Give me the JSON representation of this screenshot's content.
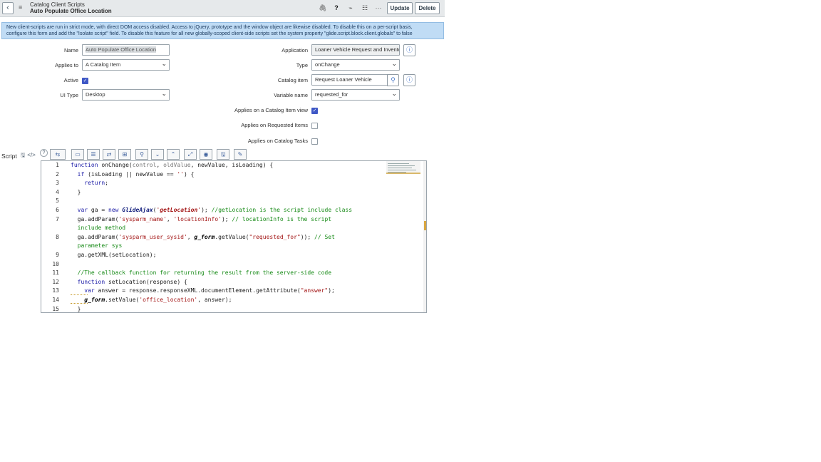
{
  "header": {
    "breadcrumb": "Catalog Client Scripts",
    "record_title": "Auto Populate Office Location",
    "icons": [
      "back-icon",
      "hamburger-menu-icon",
      "attachment-icon",
      "help-icon",
      "activity-icon",
      "settings-icon",
      "more-icon"
    ],
    "update_label": "Update",
    "delete_label": "Delete"
  },
  "banner": {
    "line1": "New client-scripts are run in strict mode, with direct DOM access disabled. Access to jQuery, prototype and the window object are likewise disabled. To disable this on a per-script basis,",
    "line2": "configure this form and add the \"Isolate script\" field. To disable this feature for all new globally-scoped client-side scripts set the system property \"glide.script.block.client.globals\" to false"
  },
  "form": {
    "name_label": "Name",
    "name_value": "Auto Populate Office Location",
    "applies_to_label": "Applies to",
    "applies_to_value": "A Catalog Item",
    "active_label": "Active",
    "active": true,
    "ui_type_label": "UI Type",
    "ui_type_value": "Desktop",
    "application_label": "Application",
    "application_value": "Loaner Vehicle Request and Invento",
    "type_label": "Type",
    "type_value": "onChange",
    "catalog_item_label": "Catalog item",
    "catalog_item_value": "Request Loaner Vehicle",
    "variable_name_label": "Variable name",
    "variable_name_value": "requested_for",
    "applies_catalog_view_label": "Applies on a Catalog Item view",
    "applies_catalog_view": true,
    "applies_requested_items_label": "Applies on Requested Items",
    "applies_requested_items": false,
    "applies_catalog_tasks_label": "Applies on Catalog Tasks",
    "applies_catalog_tasks": false
  },
  "script": {
    "label": "Script",
    "line_numbers": [
      "1",
      "2",
      "3",
      "4",
      "5",
      "6",
      "7",
      "",
      "8",
      "",
      "9",
      "10",
      "11",
      "12",
      "13",
      "14",
      "15"
    ]
  }
}
